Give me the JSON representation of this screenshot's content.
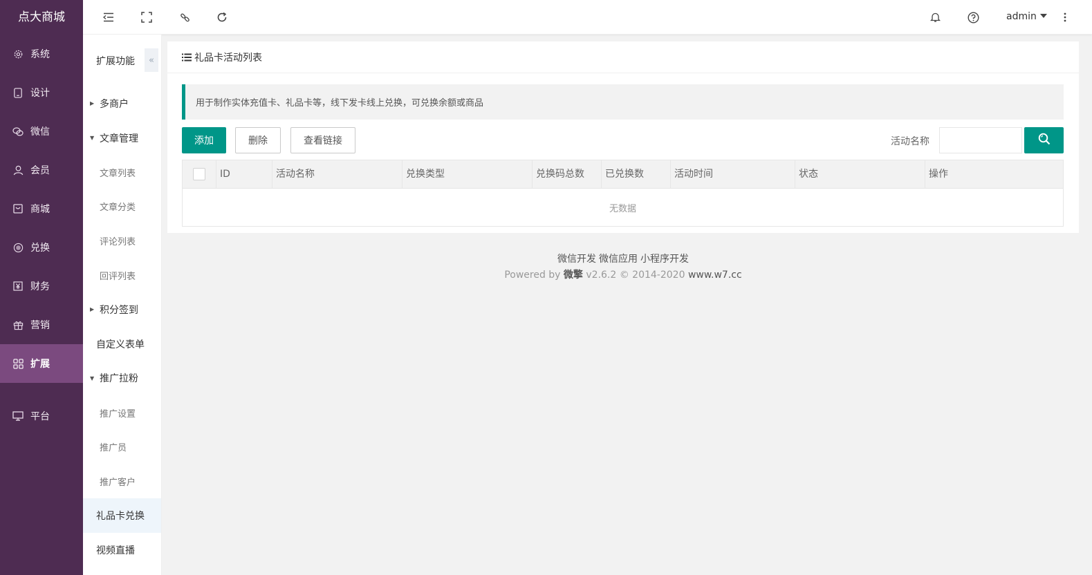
{
  "brand": "点大商城",
  "nav1": [
    {
      "label": "系统",
      "icon": "gear-icon"
    },
    {
      "label": "设计",
      "icon": "tablet-icon"
    },
    {
      "label": "微信",
      "icon": "wechat-icon"
    },
    {
      "label": "会员",
      "icon": "user-icon"
    },
    {
      "label": "商城",
      "icon": "store-icon"
    },
    {
      "label": "兑换",
      "icon": "exchange-icon"
    },
    {
      "label": "财务",
      "icon": "yen-icon"
    },
    {
      "label": "营销",
      "icon": "gift-icon"
    },
    {
      "label": "扩展",
      "icon": "grid-icon"
    },
    {
      "label": "平台",
      "icon": "monitor-icon"
    }
  ],
  "nav2": {
    "title": "扩展功能",
    "collapse": "«",
    "items": [
      {
        "label": "多商户"
      },
      {
        "label": "文章管理"
      },
      {
        "label": "文章列表"
      },
      {
        "label": "文章分类"
      },
      {
        "label": "评论列表"
      },
      {
        "label": "回评列表"
      },
      {
        "label": "积分签到"
      },
      {
        "label": "自定义表单"
      },
      {
        "label": "推广拉粉"
      },
      {
        "label": "推广设置"
      },
      {
        "label": "推广员"
      },
      {
        "label": "推广客户"
      },
      {
        "label": "礼品卡兑换"
      },
      {
        "label": "视频直播"
      }
    ]
  },
  "header": {
    "user": "admin",
    "icons": [
      "menu-fold-icon",
      "fullscreen-icon",
      "link-icon",
      "refresh-icon",
      "bell-icon",
      "help-icon",
      "more-icon"
    ]
  },
  "card": {
    "title": "礼品卡活动列表",
    "notice": "用于制作实体充值卡、礼品卡等，线下发卡线上兑换，可兑换余额或商品",
    "buttons": {
      "add": "添加",
      "delete": "删除",
      "view_link": "查看链接"
    },
    "search_label": "活动名称",
    "search_placeholder": "",
    "columns": [
      "ID",
      "活动名称",
      "兑换类型",
      "兑换码总数",
      "已兑换数",
      "活动时间",
      "状态",
      "操作"
    ],
    "empty_text": "无数据"
  },
  "footer": {
    "links": [
      "微信开发",
      "微信应用",
      "小程序开发"
    ],
    "powered_prefix": "Powered by",
    "powered_brand": "微擎",
    "powered_version": "v2.6.2 © 2014-2020",
    "powered_site": "www.w7.cc"
  },
  "colors": {
    "sidebar": "#4e2c52",
    "sidebar_active": "#7b4a7f",
    "accent": "#009688"
  }
}
